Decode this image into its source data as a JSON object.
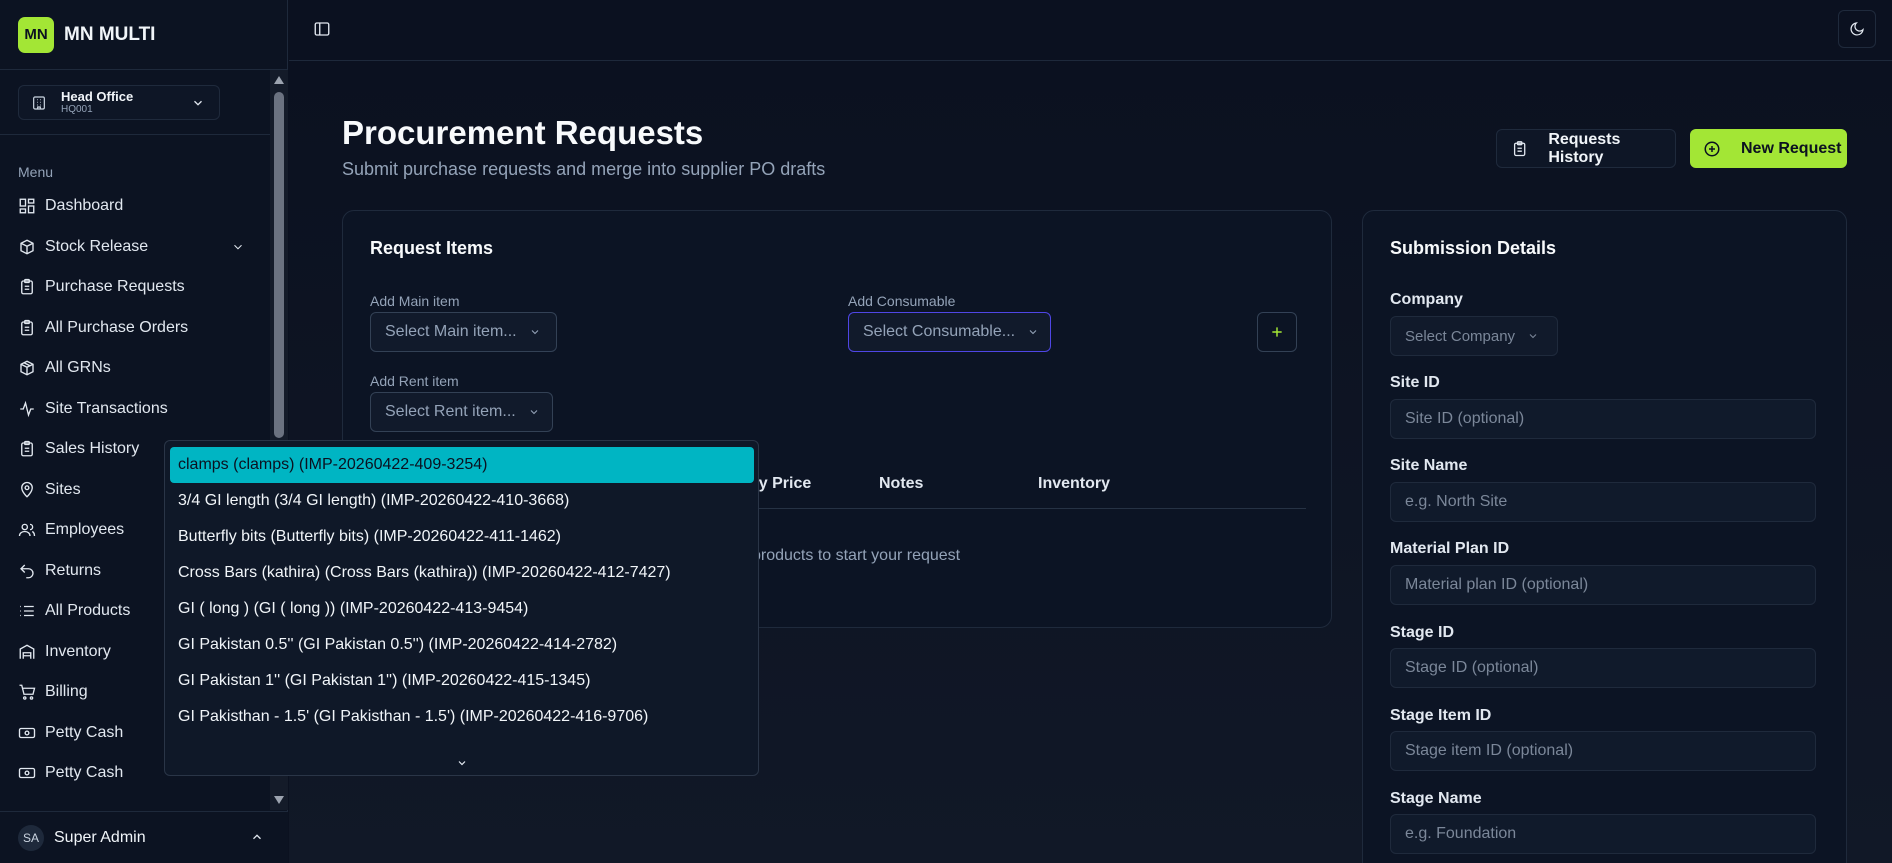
{
  "brand": {
    "logo": "MN",
    "name": "MN MULTI"
  },
  "org": {
    "name": "Head Office",
    "code": "HQ001"
  },
  "menu_label": "Menu",
  "nav": [
    {
      "label": "Dashboard",
      "icon": "dashboard-icon"
    },
    {
      "label": "Stock Release",
      "icon": "box-icon",
      "has_children": true
    },
    {
      "label": "Purchase Requests",
      "icon": "clipboard-icon"
    },
    {
      "label": "All Purchase Orders",
      "icon": "clipboard-icon"
    },
    {
      "label": "All GRNs",
      "icon": "package-icon"
    },
    {
      "label": "Site Transactions",
      "icon": "activity-icon"
    },
    {
      "label": "Sales History",
      "icon": "clipboard-icon"
    },
    {
      "label": "Sites",
      "icon": "map-pin-icon"
    },
    {
      "label": "Employees",
      "icon": "users-icon"
    },
    {
      "label": "Returns",
      "icon": "undo-icon"
    },
    {
      "label": "All Products",
      "icon": "list-icon"
    },
    {
      "label": "Inventory",
      "icon": "warehouse-icon"
    },
    {
      "label": "Billing",
      "icon": "cart-icon"
    },
    {
      "label": "Petty Cash",
      "icon": "banknote-icon"
    },
    {
      "label": "Petty Cash",
      "icon": "banknote-icon"
    }
  ],
  "user": {
    "initials": "SA",
    "name": "Super Admin"
  },
  "page": {
    "title": "Procurement Requests",
    "subtitle": "Submit purchase requests and merge into supplier PO drafts",
    "history_button": "Requests History",
    "new_button": "New Request"
  },
  "request_items": {
    "title": "Request Items",
    "main_label": "Add Main item",
    "main_placeholder": "Select Main item...",
    "consumable_label": "Add Consumable",
    "consumable_placeholder": "Select Consumable...",
    "rent_label": "Add Rent item",
    "rent_placeholder": "Select Rent item...",
    "columns": [
      "ny Price",
      "Notes",
      "Inventory"
    ],
    "empty_text": "products to start your request"
  },
  "submission": {
    "title": "Submission Details",
    "company_label": "Company",
    "company_placeholder": "Select Company",
    "fields": [
      {
        "label": "Site ID",
        "placeholder": "Site ID (optional)"
      },
      {
        "label": "Site Name",
        "placeholder": "e.g. North Site"
      },
      {
        "label": "Material Plan ID",
        "placeholder": "Material plan ID (optional)"
      },
      {
        "label": "Stage ID",
        "placeholder": "Stage ID (optional)"
      },
      {
        "label": "Stage Item ID",
        "placeholder": "Stage item ID (optional)"
      },
      {
        "label": "Stage Name",
        "placeholder": "e.g. Foundation"
      }
    ]
  },
  "dropdown": {
    "selected_index": 0,
    "options": [
      "clamps (clamps) (IMP-20260422-409-3254)",
      "3/4 GI length (3/4 GI length) (IMP-20260422-410-3668)",
      "Butterfly bits (Butterfly bits) (IMP-20260422-411-1462)",
      "Cross Bars (kathira) (Cross Bars (kathira)) (IMP-20260422-412-7427)",
      "GI ( long ) (GI ( long )) (IMP-20260422-413-9454)",
      "GI Pakistan 0.5'' (GI Pakistan 0.5'') (IMP-20260422-414-2782)",
      "GI Pakistan 1'' (GI Pakistan 1'') (IMP-20260422-415-1345)",
      "GI Pakisthan - 1.5' (GI Pakisthan - 1.5') (IMP-20260422-416-9706)"
    ]
  },
  "colors": {
    "accent": "#a3e635",
    "selected": "#00b5c3",
    "background": "#0b1120"
  }
}
